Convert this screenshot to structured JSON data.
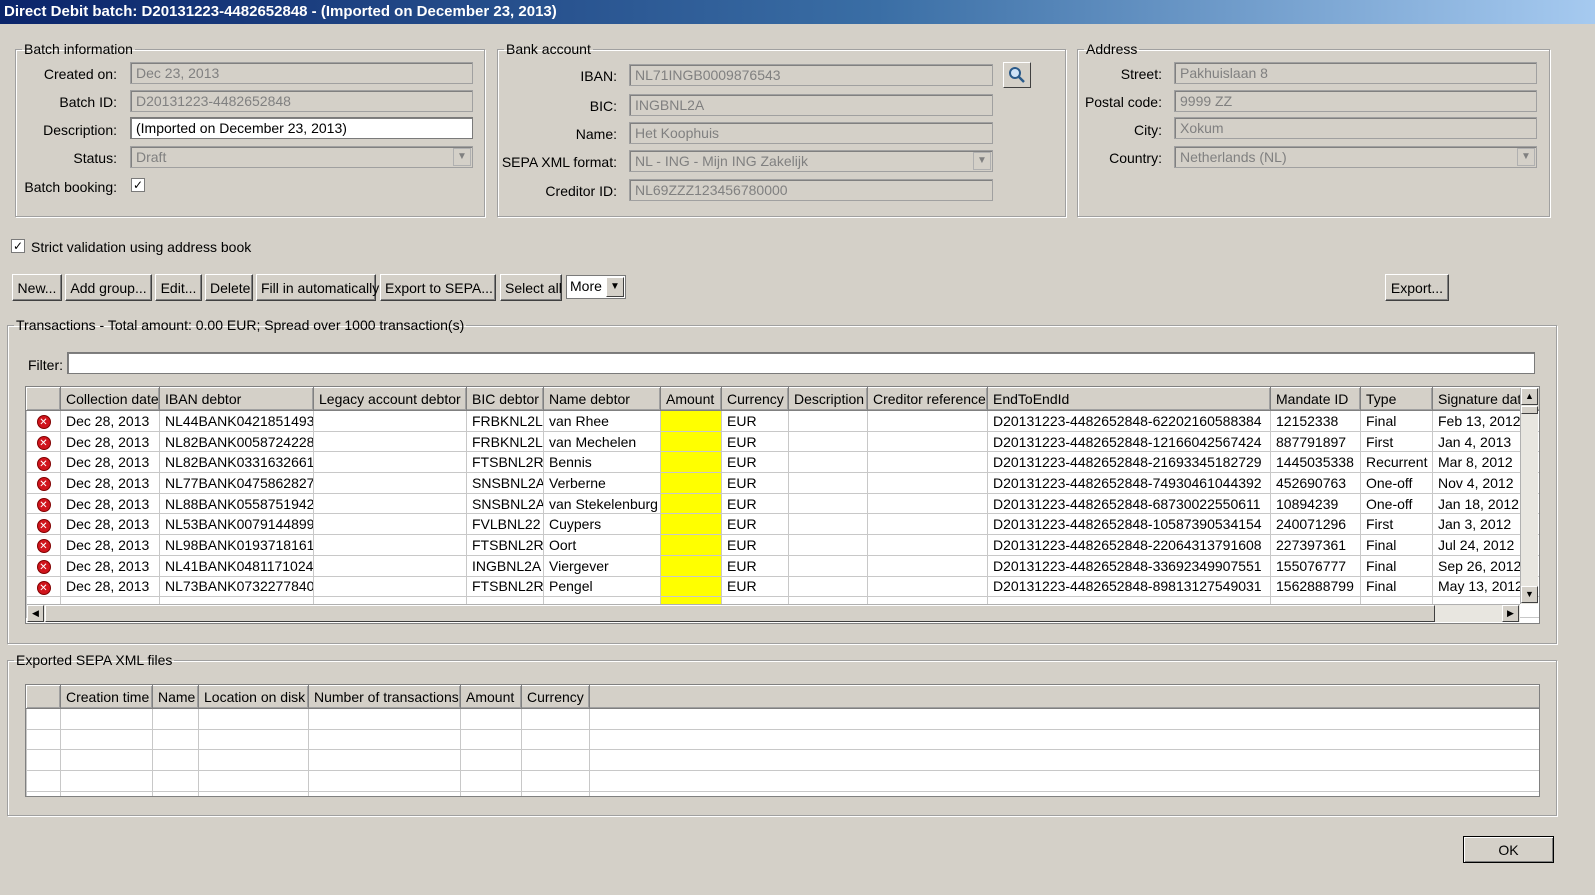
{
  "window": {
    "title": "Direct Debit batch: D20131223-4482652848 - (Imported on December 23, 2013)"
  },
  "batch": {
    "legend": "Batch information",
    "created_label": "Created on:",
    "created_value": "Dec 23, 2013",
    "id_label": "Batch ID:",
    "id_value": "D20131223-4482652848",
    "description_label": "Description:",
    "description_value": "(Imported on December 23, 2013)",
    "status_label": "Status:",
    "status_value": "Draft",
    "booking_label": "Batch booking:",
    "booking_checked": "✓"
  },
  "bank": {
    "legend": "Bank account",
    "iban_label": "IBAN:",
    "iban_value": "NL71INGB0009876543",
    "bic_label": "BIC:",
    "bic_value": "INGBNL2A",
    "name_label": "Name:",
    "name_value": "Het Koophuis",
    "format_label": "SEPA XML format:",
    "format_value": "NL - ING - Mijn ING Zakelijk",
    "creditor_label": "Creditor ID:",
    "creditor_value": "NL69ZZZ123456780000"
  },
  "address": {
    "legend": "Address",
    "street_label": "Street:",
    "street_value": "Pakhuislaan 8",
    "postal_label": "Postal code:",
    "postal_value": "9999 ZZ",
    "city_label": "City:",
    "city_value": "Xokum",
    "country_label": "Country:",
    "country_value": "Netherlands (NL)"
  },
  "strict": {
    "label": "Strict validation using address book",
    "checked": "✓"
  },
  "toolbar": {
    "new": "New...",
    "add_group": "Add group...",
    "edit": "Edit...",
    "delete": "Delete",
    "fill": "Fill in automatically",
    "export_sepa": "Export to SEPA...",
    "select_all": "Select all",
    "more": "More",
    "export": "Export..."
  },
  "transactions": {
    "legend": "Transactions - Total amount: 0.00 EUR; Spread over 1000 transaction(s)",
    "filter_label": "Filter:",
    "filter_value": "",
    "columns": [
      "",
      "Collection date",
      "IBAN debtor",
      "Legacy account debtor",
      "BIC debtor",
      "Name debtor",
      "Amount",
      "Currency",
      "Description",
      "Creditor reference",
      "EndToEndId",
      "Mandate ID",
      "Type",
      "Signature date"
    ],
    "rows": [
      [
        "Dec 28, 2013",
        "NL44BANK0421851493",
        "",
        "FRBKNL2L",
        "van Rhee",
        "",
        "EUR",
        "",
        "",
        "D20131223-4482652848-62202160588384",
        "12152338",
        "Final",
        "Feb 13, 2012"
      ],
      [
        "Dec 28, 2013",
        "NL82BANK0058724228",
        "",
        "FRBKNL2L",
        "van Mechelen",
        "",
        "EUR",
        "",
        "",
        "D20131223-4482652848-12166042567424",
        "887791897",
        "First",
        "Jan 4, 2013"
      ],
      [
        "Dec 28, 2013",
        "NL82BANK0331632661",
        "",
        "FTSBNL2R",
        "Bennis",
        "",
        "EUR",
        "",
        "",
        "D20131223-4482652848-21693345182729",
        "1445035338",
        "Recurrent",
        "Mar 8, 2012"
      ],
      [
        "Dec 28, 2013",
        "NL77BANK0475862827",
        "",
        "SNSBNL2A",
        "Verberne",
        "",
        "EUR",
        "",
        "",
        "D20131223-4482652848-74930461044392",
        "452690763",
        "One-off",
        "Nov 4, 2012"
      ],
      [
        "Dec 28, 2013",
        "NL88BANK0558751942",
        "",
        "SNSBNL2A",
        "van Stekelenburg",
        "",
        "EUR",
        "",
        "",
        "D20131223-4482652848-68730022550611",
        "10894239",
        "One-off",
        "Jan 18, 2012"
      ],
      [
        "Dec 28, 2013",
        "NL53BANK0079144899",
        "",
        "FVLBNL22",
        "Cuypers",
        "",
        "EUR",
        "",
        "",
        "D20131223-4482652848-10587390534154",
        "240071296",
        "First",
        "Jan 3, 2012"
      ],
      [
        "Dec 28, 2013",
        "NL98BANK0193718161",
        "",
        "FTSBNL2R",
        "Oort",
        "",
        "EUR",
        "",
        "",
        "D20131223-4482652848-22064313791608",
        "227397361",
        "Final",
        "Jul 24, 2012"
      ],
      [
        "Dec 28, 2013",
        "NL41BANK0481171024",
        "",
        "INGBNL2A",
        "Viergever",
        "",
        "EUR",
        "",
        "",
        "D20131223-4482652848-33692349907551",
        "155076777",
        "Final",
        "Sep 26, 2012"
      ],
      [
        "Dec 28, 2013",
        "NL73BANK0732277840",
        "",
        "FTSBNL2R",
        "Pengel",
        "",
        "EUR",
        "",
        "",
        "D20131223-4482652848-89813127549031",
        "1562888799",
        "Final",
        "May 13, 2012"
      ]
    ]
  },
  "exported": {
    "legend": "Exported SEPA XML files",
    "columns": [
      "",
      "Creation time",
      "Name",
      "Location on disk",
      "Number of transactions",
      "Amount",
      "Currency"
    ]
  },
  "footer": {
    "ok": "OK"
  },
  "icons": {
    "error": "error-icon",
    "search": "search-icon"
  },
  "colors": {
    "title_start": "#0a246a",
    "title_end": "#a6caf0",
    "highlight": "#ffff00",
    "error": "#d0141c"
  }
}
